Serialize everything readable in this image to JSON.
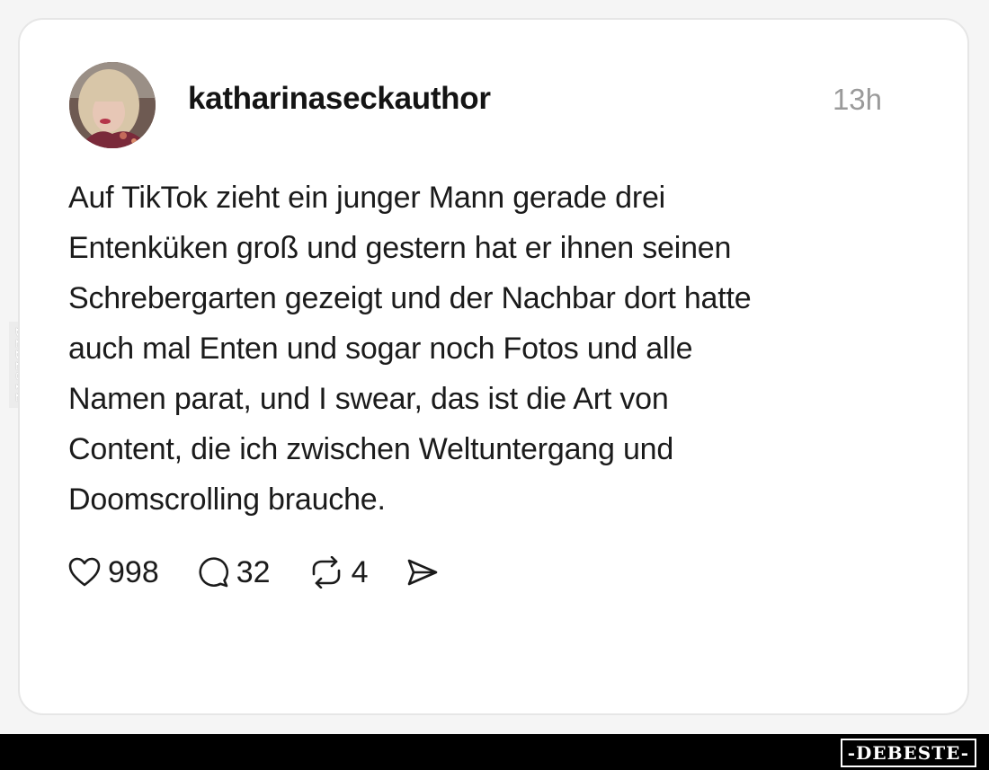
{
  "post": {
    "username": "katharinaseckauthor",
    "time": "13h",
    "text": "Auf TikTok zieht ein junger Mann gerade drei\nEntenküken groß und gestern hat er ihnen seinen\nSchrebergarten gezeigt und der Nachbar dort hatte\nauch mal Enten und sogar noch Fotos und alle\nNamen parat, und I swear, das ist die Art von\nContent, die ich zwischen Weltuntergang und\nDoomscrolling brauche.",
    "actions": {
      "likes": "998",
      "comments": "32",
      "reposts": "4"
    }
  },
  "icons": {
    "like": "heart-icon",
    "comment": "speech-bubble-icon",
    "repost": "repost-arrows-icon",
    "share": "send-icon"
  },
  "watermark": {
    "side": "DEBESTE",
    "logo": "-DEBESTE-"
  },
  "colors": {
    "text": "#1b1b1b",
    "muted": "#9a9a9a",
    "card_border": "#e6e6e6",
    "bar": "#000000"
  }
}
